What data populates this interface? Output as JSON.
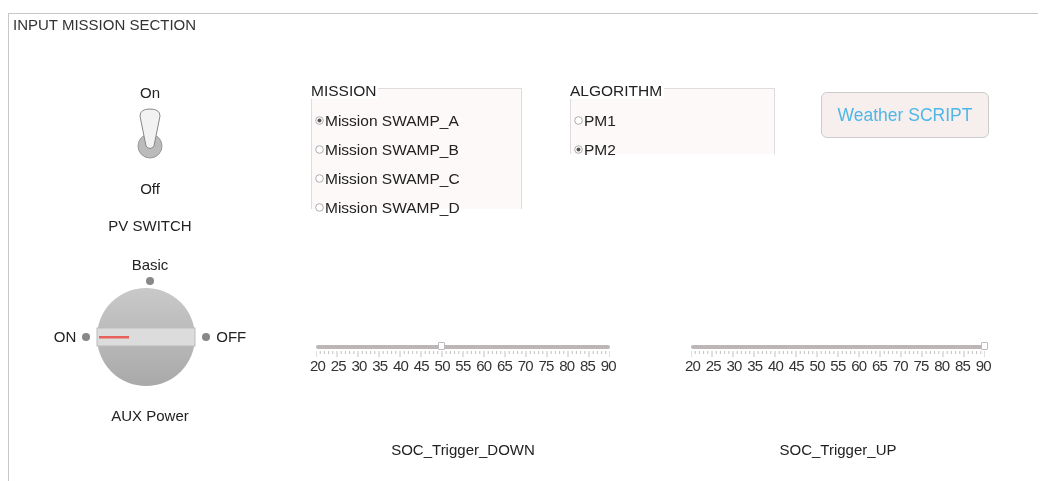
{
  "section": {
    "title": "INPUT MISSION SECTION"
  },
  "pv_switch": {
    "on_label": "On",
    "off_label": "Off",
    "label": "PV SWITCH",
    "on": true
  },
  "aux_power": {
    "label": "AUX Power",
    "options": [
      {
        "label": "Basic",
        "kind": "top",
        "selected": false
      },
      {
        "label": "ON",
        "kind": "left",
        "selected": true
      },
      {
        "label": "OFF",
        "kind": "right",
        "selected": false
      }
    ]
  },
  "mission": {
    "title": "MISSION",
    "options": [
      {
        "label": "Mission SWAMP_A",
        "selected": true
      },
      {
        "label": "Mission SWAMP_B",
        "selected": false
      },
      {
        "label": "Mission SWAMP_C",
        "selected": false
      },
      {
        "label": "Mission SWAMP_D",
        "selected": false
      }
    ]
  },
  "algorithm": {
    "title": "ALGORITHM",
    "options": [
      {
        "label": "PM1",
        "selected": false
      },
      {
        "label": "PM2",
        "selected": true
      }
    ]
  },
  "weather_button": {
    "label": "Weather SCRIPT"
  },
  "sliders": [
    {
      "label": "SOC_Trigger_DOWN",
      "level": 0.43,
      "ticks": [
        "20",
        "25",
        "30",
        "35",
        "40",
        "45",
        "50",
        "55",
        "60",
        "65",
        "70",
        "75",
        "80",
        "85",
        "90"
      ]
    },
    {
      "label": "SOC_Trigger_UP",
      "level": 1.0,
      "ticks": [
        "20",
        "25",
        "30",
        "35",
        "40",
        "45",
        "50",
        "55",
        "60",
        "65",
        "70",
        "75",
        "80",
        "85",
        "90"
      ]
    }
  ]
}
